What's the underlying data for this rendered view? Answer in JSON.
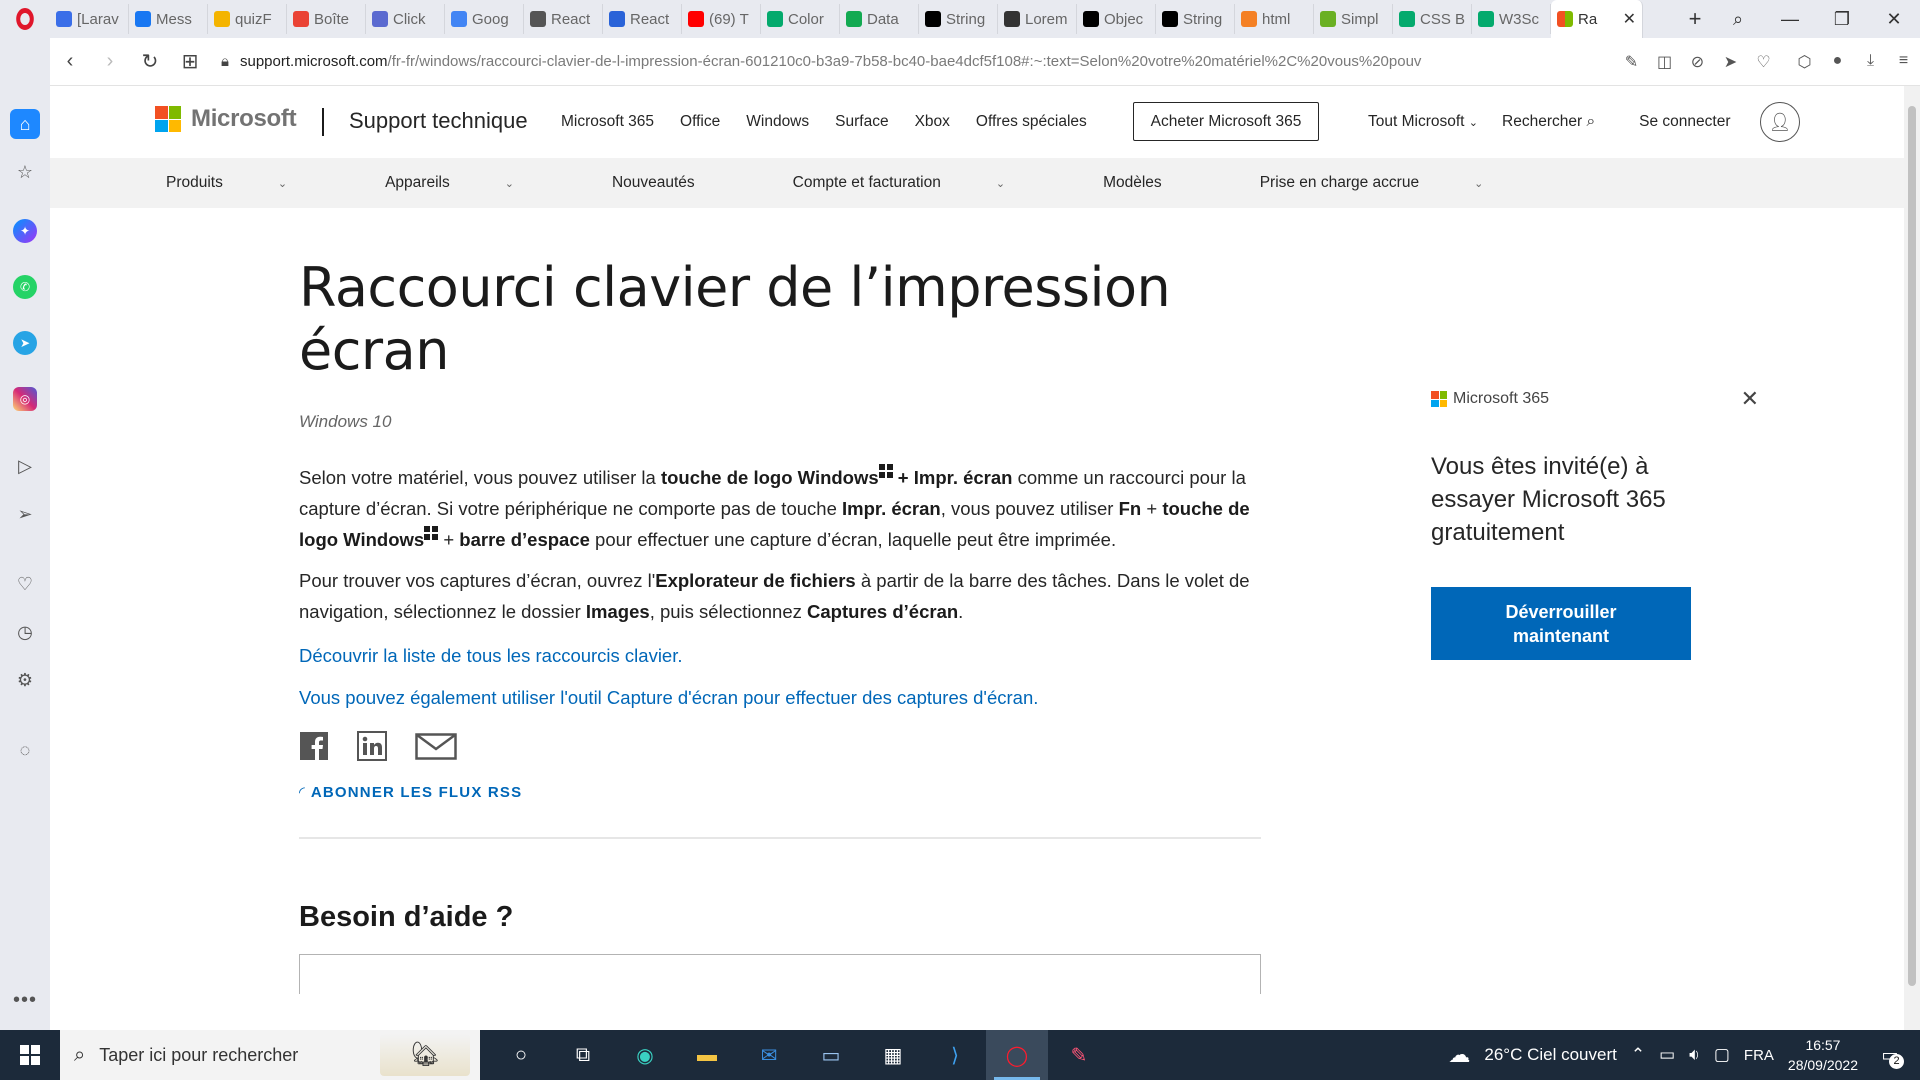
{
  "browser": {
    "tabs": [
      {
        "label": "[Larav",
        "icon": "doc-icon",
        "color": "#3a6ee8"
      },
      {
        "label": "Mess",
        "icon": "facebook-icon",
        "color": "#1877f2"
      },
      {
        "label": "quizF",
        "icon": "drive-icon",
        "color": "#f4b400"
      },
      {
        "label": "Boîte",
        "icon": "gmail-icon",
        "color": "#ea4335"
      },
      {
        "label": "Click",
        "icon": "click-icon",
        "color": "#5b6ad0"
      },
      {
        "label": "Goog",
        "icon": "translate-icon",
        "color": "#4285f4"
      },
      {
        "label": "React",
        "icon": "react-icon",
        "color": "#555555"
      },
      {
        "label": "React",
        "icon": "u-icon",
        "color": "#2a63d8"
      },
      {
        "label": "(69) T",
        "icon": "youtube-icon",
        "color": "#ff0000"
      },
      {
        "label": "Color",
        "icon": "w3-icon",
        "color": "#04aa6d"
      },
      {
        "label": "Data",
        "icon": "mongo-icon",
        "color": "#13aa52"
      },
      {
        "label": "String",
        "icon": "mdn-icon",
        "color": "#000000"
      },
      {
        "label": "Lorem",
        "icon": "l-icon",
        "color": "#333333"
      },
      {
        "label": "Objec",
        "icon": "mdn-icon",
        "color": "#000000"
      },
      {
        "label": "String",
        "icon": "mdn-icon",
        "color": "#000000"
      },
      {
        "label": "html",
        "icon": "stack-icon",
        "color": "#f48024"
      },
      {
        "label": "Simpl",
        "icon": "simpl-icon",
        "color": "#6ab023"
      },
      {
        "label": "CSS B",
        "icon": "w3-icon",
        "color": "#04aa6d"
      },
      {
        "label": "W3Sc",
        "icon": "w3-icon",
        "color": "#04aa6d"
      }
    ],
    "active_tab": {
      "label": "Ra",
      "icon": "microsoft-icon"
    },
    "url_domain": "support.microsoft.com",
    "url_rest": "/fr-fr/windows/raccourci-clavier-de-l-impression-écran-601210c0-b3a9-7b58-bc40-bae4dcf5f108#:~:text=Selon%20votre%20matériel%2C%20vous%20pouv"
  },
  "header": {
    "brand": "Microsoft",
    "section": "Support technique",
    "links": [
      "Microsoft 365",
      "Office",
      "Windows",
      "Surface",
      "Xbox",
      "Offres spéciales"
    ],
    "buy_button": "Acheter Microsoft 365",
    "all_microsoft": "Tout Microsoft",
    "search": "Rechercher",
    "sign_in": "Se connecter"
  },
  "subnav": {
    "items": [
      {
        "label": "Produits",
        "dropdown": true
      },
      {
        "label": "Appareils",
        "dropdown": true
      },
      {
        "label": "Nouveautés",
        "dropdown": false
      },
      {
        "label": "Compte et facturation",
        "dropdown": true
      },
      {
        "label": "Modèles",
        "dropdown": false
      },
      {
        "label": "Prise en charge accrue",
        "dropdown": true
      }
    ]
  },
  "article": {
    "title": "Raccourci clavier de l’impression écran",
    "applies_to": "Windows 10",
    "p1": {
      "t1": "Selon votre matériel, vous pouvez utiliser la ",
      "b1": "touche de logo Windows",
      "b2": " + Impr. écran",
      "t2": " comme un raccourci pour la capture d’écran. Si votre périphérique ne comporte pas de touche ",
      "b3": "Impr. écran",
      "t3": ", vous pouvez utiliser ",
      "b4": "Fn",
      "t4": " + ",
      "b5": "touche de logo Windows",
      "t5": " + ",
      "b6": "barre d’espace",
      "t6": " pour effectuer une capture d’écran, laquelle peut être imprimée."
    },
    "p2": {
      "t1": "Pour trouver vos captures d’écran, ouvrez l'",
      "b1": "Explorateur de fichiers",
      "t2": " à partir de la barre des tâches. Dans le volet de navigation, sélectionnez le dossier ",
      "b2": "Images",
      "t3": ", puis sélectionnez ",
      "b3": "Captures d’écran",
      "t4": "."
    },
    "link1": "Découvrir la liste de tous les raccourcis clavier.",
    "link2": "Vous pouvez également utiliser l'outil Capture d'écran pour effectuer des captures d'écran.",
    "rss": "ABONNER LES FLUX RSS",
    "help_title": "Besoin d’aide ?"
  },
  "promo": {
    "brand": "Microsoft 365",
    "text": "Vous êtes invité(e) à essayer Microsoft 365 gratuitement",
    "button": "Déverrouiller maintenant"
  },
  "taskbar": {
    "search_placeholder": "Taper ici pour rechercher",
    "weather": "26°C  Ciel couvert",
    "lang": "FRA",
    "time": "16:57",
    "date": "28/09/2022",
    "notifications": "2"
  },
  "colors": {
    "ms_red": "#f25022",
    "ms_green": "#7fba00",
    "ms_blue": "#00a4ef",
    "ms_yellow": "#ffb900",
    "link": "#0067b8"
  }
}
